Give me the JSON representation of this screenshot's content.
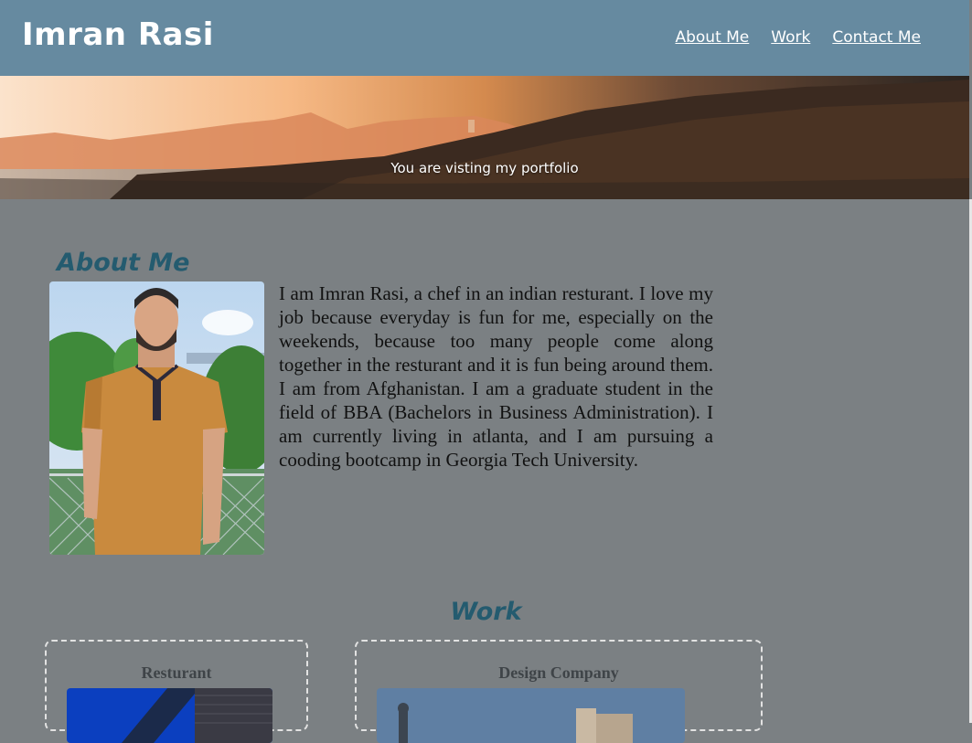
{
  "header": {
    "title": "Imran Rasi",
    "nav": [
      "About Me",
      "Work",
      "Contact Me"
    ]
  },
  "hero": {
    "tagline": "You are visting my portfolio"
  },
  "about": {
    "heading": "About Me",
    "text": "I am Imran Rasi, a chef in an indian resturant. I love my job because everyday is fun for me, especially on the weekends, because too many people come along together in the resturant and it is fun being around them. I am from Afghanistan. I am a graduate student in the field of BBA (Bachelors in Business Administration). I am currently living in atlanta, and I am pursuing a cooding bootcamp in Georgia Tech University."
  },
  "work": {
    "heading": "Work",
    "cards": [
      {
        "title": "Resturant"
      },
      {
        "title": "Design Company"
      }
    ]
  },
  "colors": {
    "header_bg": "#668aa0",
    "page_bg": "#7b8083",
    "heading_accent": "#245b6f"
  }
}
